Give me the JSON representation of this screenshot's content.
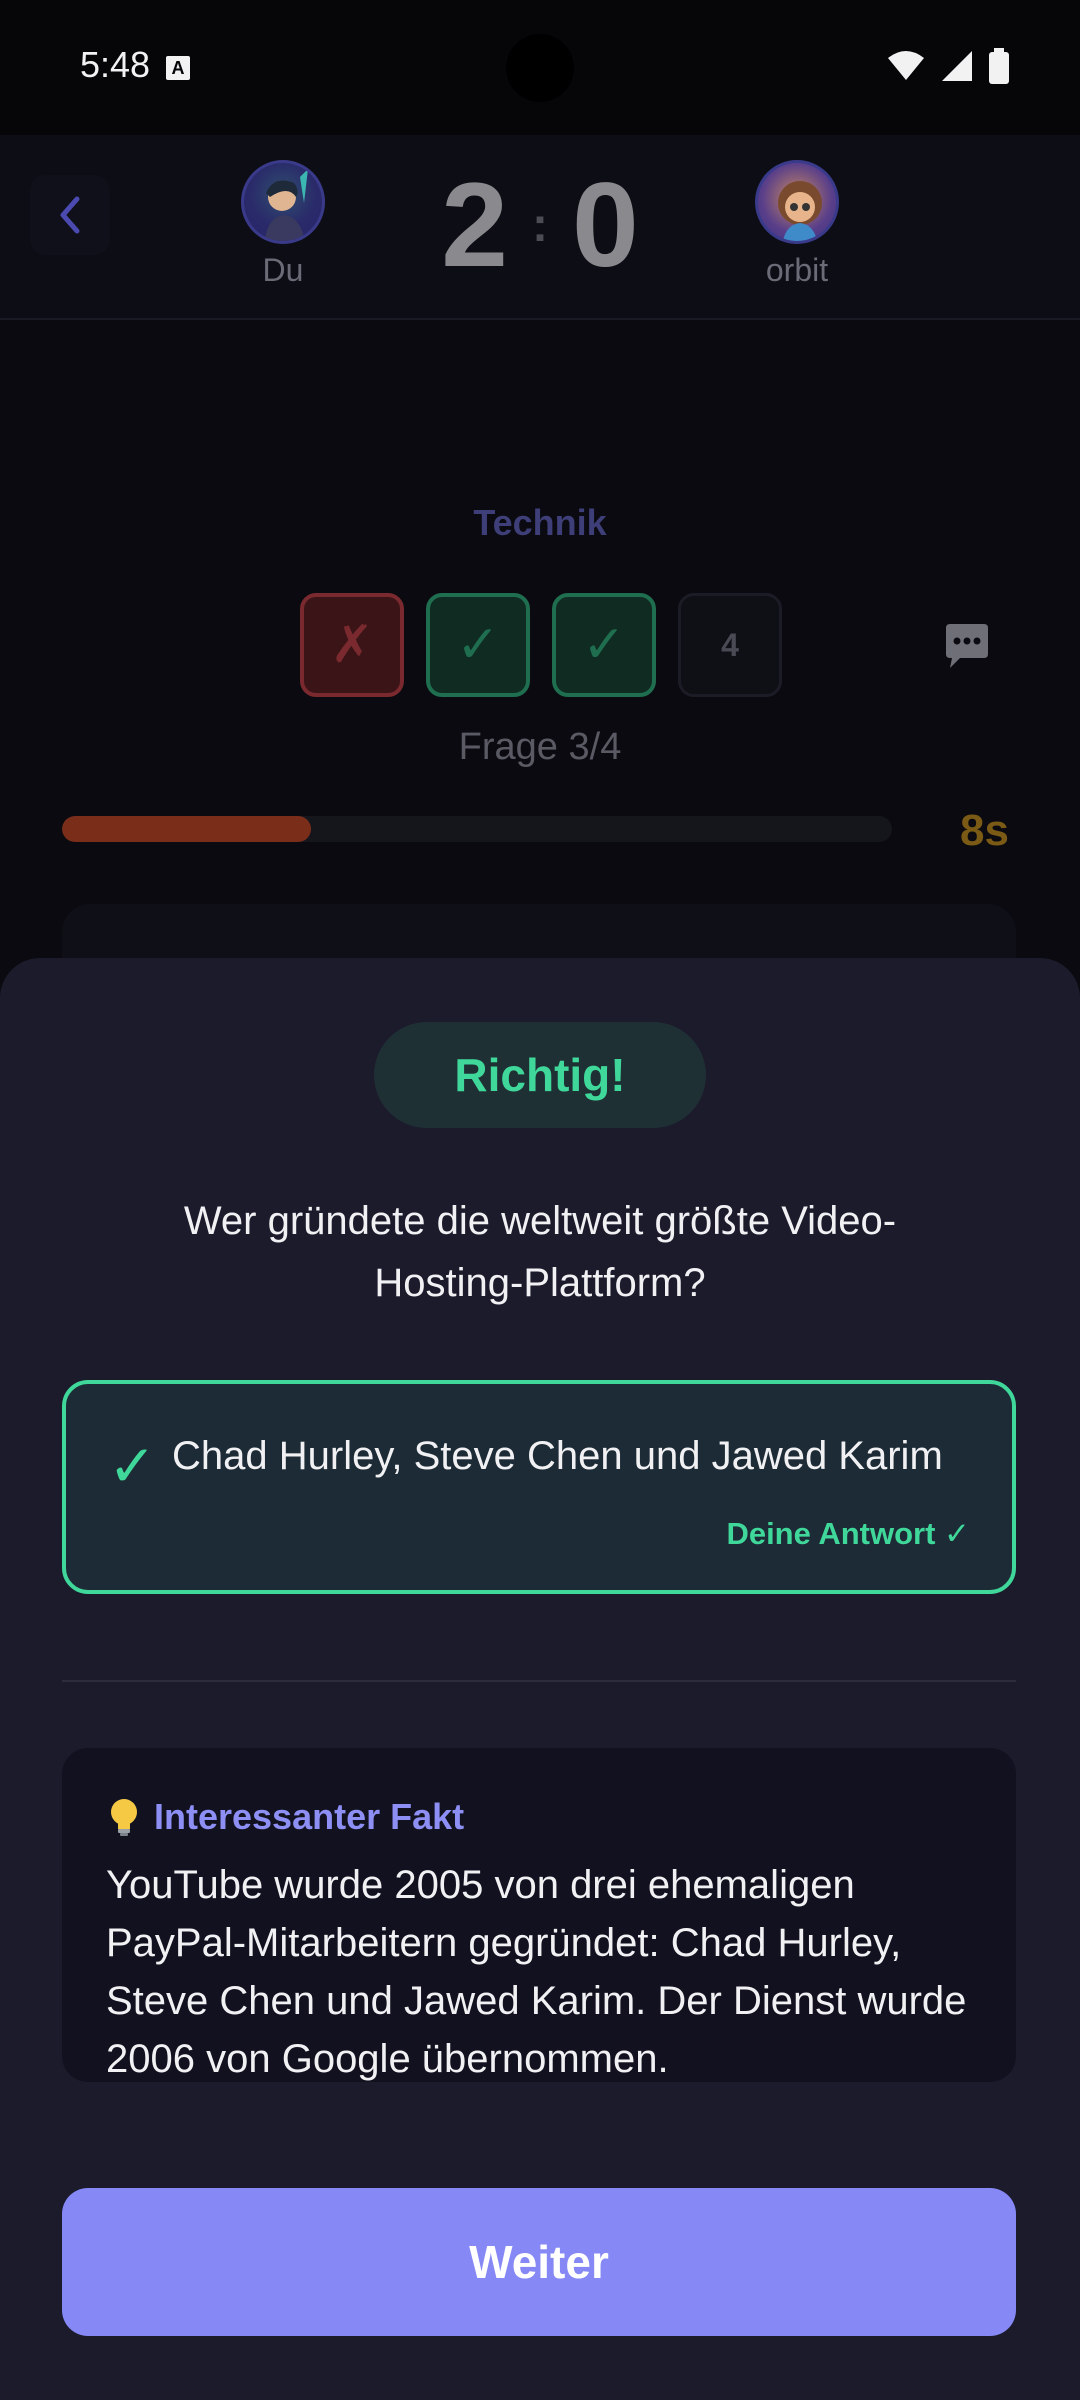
{
  "status_bar": {
    "time": "5:48",
    "notification_icon": "A"
  },
  "header": {
    "player_left": {
      "name": "Du"
    },
    "player_right": {
      "name": "orbit"
    },
    "score_left": "2",
    "score_separator": ":",
    "score_right": "0"
  },
  "quiz": {
    "category": "Technik",
    "rounds": [
      {
        "state": "wrong",
        "symbol": "✗"
      },
      {
        "state": "right",
        "symbol": "✓"
      },
      {
        "state": "right",
        "symbol": "✓"
      },
      {
        "state": "pending",
        "symbol": "4"
      }
    ],
    "question_counter": "Frage 3/4",
    "timer_remaining_fraction": 0.3,
    "timer_label": "8s"
  },
  "result_sheet": {
    "badge": "Richtig!",
    "question": "Wer gründete die weltweit größte Video-Hosting-Plattform?",
    "answer_check": "✓",
    "answer": "Chad Hurley, Steve Chen und Jawed Karim",
    "your_answer_label": "Deine Antwort ✓",
    "fact_title": "Interessanter Fakt",
    "fact_text": "YouTube wurde 2005 von drei ehemaligen PayPal-Mitarbeitern gegründet: Chad Hurley, Steve Chen und Jawed Karim. Der Dienst wurde 2006 von Google übernommen.",
    "next_button": "Weiter"
  },
  "colors": {
    "accent": "#8689f5",
    "correct": "#3fd79a",
    "sheet_bg": "#1b1b2c"
  }
}
